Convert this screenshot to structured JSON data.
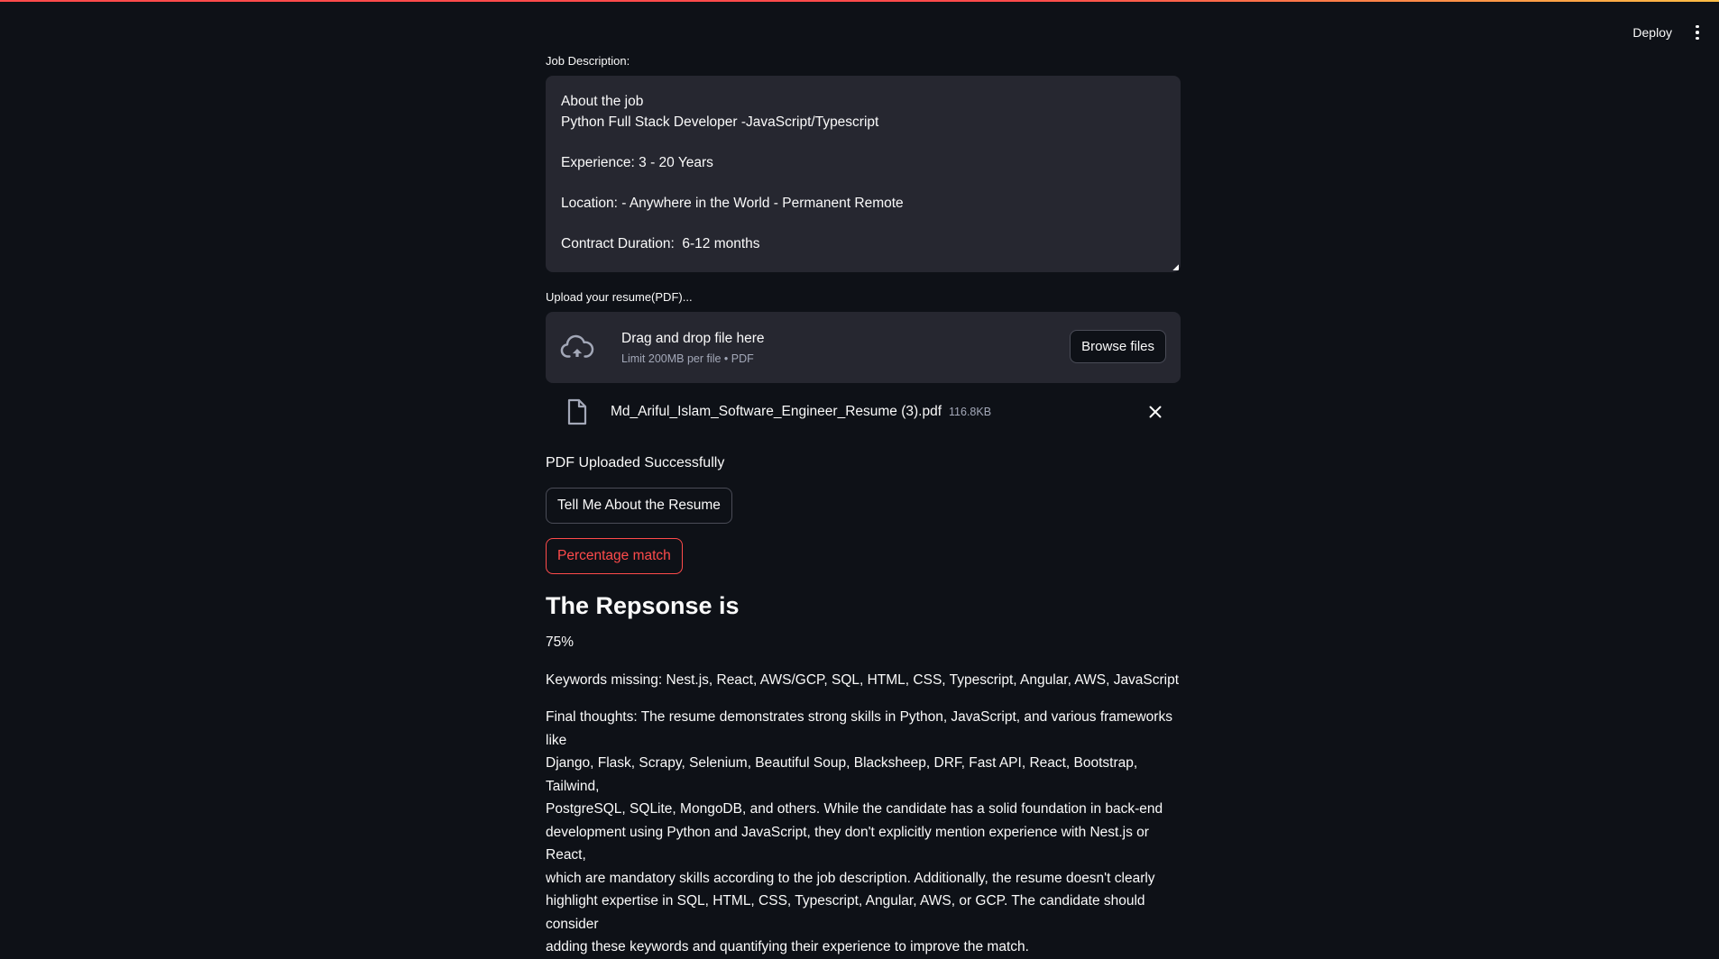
{
  "header": {
    "deploy_label": "Deploy",
    "menu_icon": "kebab-menu-icon"
  },
  "job_description": {
    "label": "Job Description:",
    "lines": [
      "About the job",
      "Python Full Stack Developer -JavaScript/Typescript",
      "",
      "Experience: 3 - 20 Years",
      "",
      "Location: - Anywhere in the World - Permanent Remote",
      "",
      "Contract Duration:  6-12 months"
    ]
  },
  "uploader": {
    "label": "Upload your resume(PDF)...",
    "icon": "cloud-upload-icon",
    "drag_text": "Drag and drop file here",
    "limit_text": "Limit 200MB per file • PDF",
    "browse_label": "Browse files"
  },
  "uploaded_file": {
    "icon": "file-icon",
    "name": "Md_Ariful_Islam_Software_Engineer_Resume (3).pdf",
    "size": "116.8KB",
    "remove_icon": "close-icon"
  },
  "status_text": "PDF Uploaded Successfully",
  "buttons": {
    "tell_me": "Tell Me About the Resume",
    "percentage": "Percentage match"
  },
  "response": {
    "heading": "The Repsonse is",
    "score": "75%",
    "keywords": "Keywords missing: Nest.js, React, AWS/GCP, SQL, HTML, CSS, Typescript, Angular, AWS, JavaScript",
    "final_lines": [
      "Final thoughts: The resume demonstrates strong skills in Python, JavaScript, and various frameworks like",
      "Django, Flask, Scrapy, Selenium, Beautiful Soup, Blacksheep, DRF, Fast API, React, Bootstrap, Tailwind,",
      "PostgreSQL, SQLite, MongoDB, and others. While the candidate has a solid foundation in back-end",
      "development using Python and JavaScript, they don't explicitly mention experience with Nest.js or React,",
      "which are mandatory skills according to the job description. Additionally, the resume doesn't clearly",
      "highlight expertise in SQL, HTML, CSS, Typescript, Angular, AWS, or GCP. The candidate should consider",
      "adding these keywords and quantifying their experience to improve the match."
    ]
  },
  "colors": {
    "background": "#0e1117",
    "surface": "#262730",
    "accent": "#ff4b4b",
    "muted_text": "#a3a8b8"
  }
}
